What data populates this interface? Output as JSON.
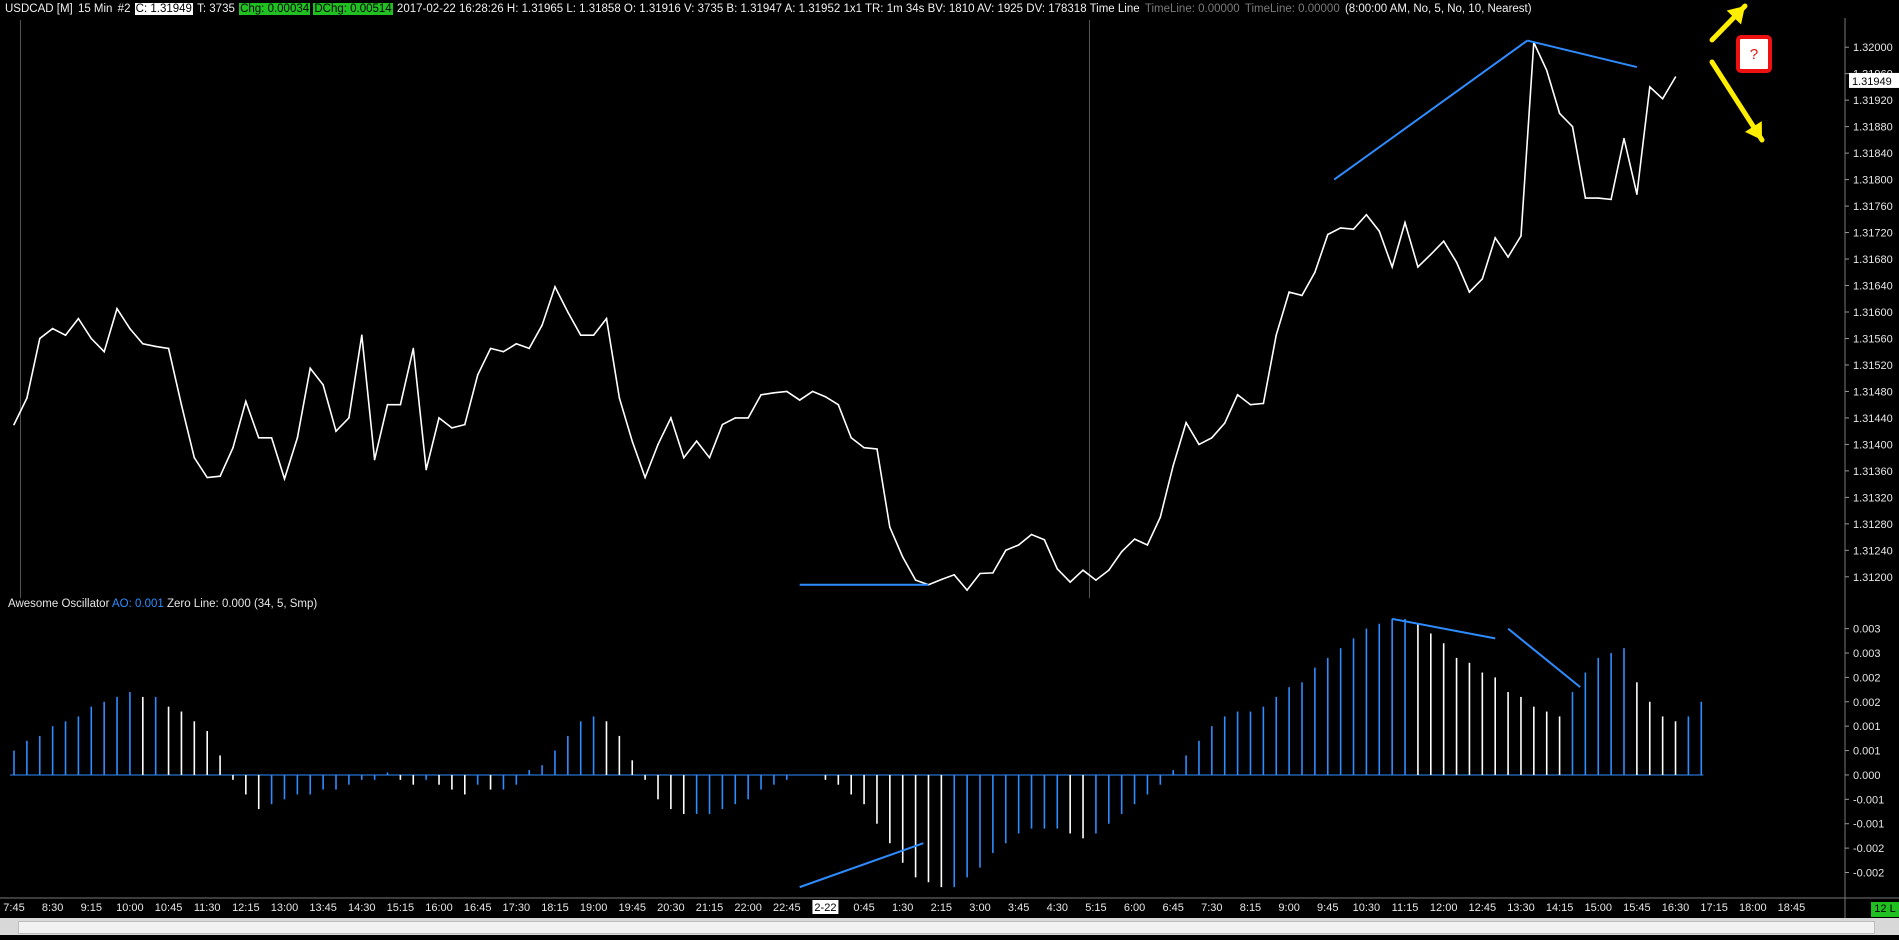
{
  "header": {
    "symbol": "USDCAD [M]",
    "interval": "15 Min",
    "chart_num": "#2",
    "close_label": "C: 1.31949",
    "ticks": "T: 3735",
    "chg": "Chg: 0.00034",
    "dchg": "DChg: 0.00514",
    "rest": "2017-02-22 16:28:26 H: 1.31965 L: 1.31858 O: 1.31916 V: 3735 B: 1.31947 A: 1.31952 1x1 TR: 1m 34s BV: 1810 AV: 1925 DV: 178318 Time Line",
    "timeline1": "TimeLine: 0.00000",
    "timeline2": "TimeLine: 0.00000",
    "params": "(8:00:00 AM, No, 5, No, 10, Nearest)"
  },
  "ao_header": {
    "name": "Awesome Oscillator",
    "value": "AO: 0.001",
    "zero": "Zero Line: 0.000",
    "params": "(34, 5, Smp)"
  },
  "question_mark": "?",
  "corner_badge": "12 L",
  "colors": {
    "background": "#000000",
    "price_line": "#ffffff",
    "ao_up": "#2f8cff",
    "ao_down": "#ffffff",
    "trend_lines": "#2f8cff",
    "arrows": "#ffee00",
    "axis_text": "#e6e6e6"
  },
  "chart_data": [
    {
      "type": "line",
      "title": "USDCAD [M] 15 Min",
      "ylim": [
        1.31165,
        1.32035
      ],
      "y_ticks": [
        "1.32000",
        "1.31960",
        "1.31920",
        "1.31880",
        "1.31840",
        "1.31800",
        "1.31760",
        "1.31720",
        "1.31680",
        "1.31640",
        "1.31600",
        "1.31560",
        "1.31520",
        "1.31480",
        "1.31440",
        "1.31400",
        "1.31360",
        "1.31320",
        "1.31280",
        "1.31240",
        "1.31200"
      ],
      "y_tick_values": [
        1.32,
        1.3196,
        1.3192,
        1.3188,
        1.3184,
        1.318,
        1.3176,
        1.3172,
        1.3168,
        1.3164,
        1.316,
        1.3156,
        1.3152,
        1.3148,
        1.3144,
        1.314,
        1.3136,
        1.3132,
        1.3128,
        1.3124,
        1.312
      ],
      "last_price_label": "1.31949",
      "last_price": 1.31949,
      "values": [
        1.3143,
        1.3147,
        1.3156,
        1.31575,
        1.31565,
        1.3159,
        1.3156,
        1.3154,
        1.31605,
        1.31575,
        1.31552,
        1.31548,
        1.31545,
        1.3146,
        1.3138,
        1.3135,
        1.31352,
        1.31395,
        1.31465,
        1.3141,
        1.3141,
        1.31348,
        1.3141,
        1.31515,
        1.3149,
        1.3142,
        1.3144,
        1.31565,
        1.31377,
        1.3146,
        1.3146,
        1.31545,
        1.31362,
        1.3144,
        1.31425,
        1.3143,
        1.31505,
        1.31545,
        1.3154,
        1.31552,
        1.31545,
        1.3158,
        1.31638,
        1.316,
        1.31565,
        1.31565,
        1.3159,
        1.3147,
        1.31405,
        1.3135,
        1.314,
        1.3144,
        1.3138,
        1.31405,
        1.3138,
        1.3143,
        1.3144,
        1.3144,
        1.31475,
        1.31478,
        1.3148,
        1.31467,
        1.3148,
        1.31472,
        1.3146,
        1.3141,
        1.31395,
        1.31393,
        1.31275,
        1.3123,
        1.31195,
        1.31188,
        1.31196,
        1.31203,
        1.3118,
        1.31205,
        1.31206,
        1.3124,
        1.31248,
        1.31264,
        1.31256,
        1.31212,
        1.31192,
        1.3121,
        1.31195,
        1.3121,
        1.31238,
        1.31257,
        1.31248,
        1.3129,
        1.31368,
        1.31433,
        1.314,
        1.3141,
        1.31432,
        1.31475,
        1.3146,
        1.31462,
        1.31565,
        1.3163,
        1.31625,
        1.3166,
        1.31717,
        1.31727,
        1.31725,
        1.31747,
        1.31722,
        1.31668,
        1.31735,
        1.31668,
        1.31687,
        1.31707,
        1.31675,
        1.3163,
        1.3165,
        1.31712,
        1.31683,
        1.31715,
        1.32007,
        1.31965,
        1.319,
        1.3188,
        1.31772,
        1.31772,
        1.3177,
        1.31862,
        1.31778,
        1.3194,
        1.31922,
        1.31955
      ],
      "x_tick_labels": [
        "7:45",
        "8:30",
        "9:15",
        "10:00",
        "10:45",
        "11:30",
        "12:15",
        "13:00",
        "13:45",
        "14:30",
        "15:15",
        "16:00",
        "16:45",
        "17:30",
        "18:15",
        "19:00",
        "19:45",
        "20:30",
        "21:15",
        "22:00",
        "22:45",
        "2-22",
        "0:45",
        "1:30",
        "2:15",
        "3:00",
        "3:45",
        "4:30",
        "5:15",
        "6:00",
        "6:45",
        "7:30",
        "8:15",
        "9:00",
        "9:45",
        "10:30",
        "11:15",
        "12:00",
        "12:45",
        "13:30",
        "14:15",
        "15:00",
        "15:45",
        "16:30",
        "17:15",
        "18:00",
        "18:45"
      ],
      "x_tick_bar_index": [
        0,
        3,
        6,
        9,
        12,
        15,
        18,
        21,
        24,
        27,
        30,
        33,
        36,
        39,
        42,
        45,
        48,
        51,
        54,
        57,
        60,
        63,
        66,
        69,
        72,
        75,
        78,
        81,
        84,
        87,
        90,
        93,
        96,
        99,
        102,
        105,
        108,
        111,
        114,
        117,
        120,
        123,
        126,
        129,
        132,
        135,
        138
      ],
      "grid": false,
      "session_dividers_bar_index": [
        0.5,
        83.5
      ]
    },
    {
      "type": "bar",
      "title": "Awesome Oscillator",
      "ylim": [
        -0.0024,
        0.0033
      ],
      "y_ticks": [
        "0.003",
        "0.003",
        "0.002",
        "0.002",
        "0.001",
        "0.001",
        "0.000",
        "-0.001",
        "-0.001",
        "-0.002",
        "-0.002"
      ],
      "y_tick_values": [
        0.003,
        0.0025,
        0.002,
        0.0015,
        0.001,
        0.0005,
        0.0,
        -0.0005,
        -0.001,
        -0.0015,
        -0.002
      ],
      "values": [
        0.0005,
        0.0007,
        0.0008,
        0.001,
        0.0011,
        0.0012,
        0.0014,
        0.0015,
        0.0016,
        0.0017,
        0.0016,
        0.0016,
        0.0014,
        0.0013,
        0.0011,
        0.0009,
        0.0004,
        -0.0001,
        -0.0004,
        -0.0007,
        -0.0006,
        -0.0005,
        -0.0004,
        -0.0004,
        -0.0003,
        -0.0003,
        -0.0002,
        -0.0001,
        -0.0001,
        5e-05,
        -0.0001,
        -0.0002,
        -0.0001,
        -0.0002,
        -0.0003,
        -0.0004,
        -0.0002,
        -0.0003,
        -0.0003,
        -0.0002,
        0.0001,
        0.0002,
        0.0005,
        0.0008,
        0.0011,
        0.0012,
        0.0011,
        0.0008,
        0.0003,
        -0.0001,
        -0.0005,
        -0.0007,
        -0.0008,
        -0.0008,
        -0.0008,
        -0.0007,
        -0.0006,
        -0.0005,
        -0.0003,
        -0.0002,
        -0.0001,
        0.0,
        0.0,
        -0.0001,
        -0.0002,
        -0.0004,
        -0.0006,
        -0.001,
        -0.0014,
        -0.0018,
        -0.0021,
        -0.0022,
        -0.0023,
        -0.0023,
        -0.0021,
        -0.0019,
        -0.0016,
        -0.0014,
        -0.0012,
        -0.0011,
        -0.0011,
        -0.0011,
        -0.0012,
        -0.0013,
        -0.0012,
        -0.001,
        -0.0008,
        -0.0006,
        -0.0004,
        -0.0002,
        0.0001,
        0.0004,
        0.0007,
        0.001,
        0.0012,
        0.0013,
        0.0013,
        0.0014,
        0.0016,
        0.0018,
        0.0019,
        0.0022,
        0.0024,
        0.0026,
        0.0028,
        0.003,
        0.0031,
        0.0032,
        0.0032,
        0.0031,
        0.0029,
        0.0027,
        0.0024,
        0.0023,
        0.0021,
        0.002,
        0.0017,
        0.0016,
        0.0014,
        0.0013,
        0.0012,
        0.0017,
        0.0021,
        0.0024,
        0.0025,
        0.0026,
        0.0019,
        0.0015,
        0.0012,
        0.0011,
        0.0012,
        0.0015
      ]
    }
  ]
}
